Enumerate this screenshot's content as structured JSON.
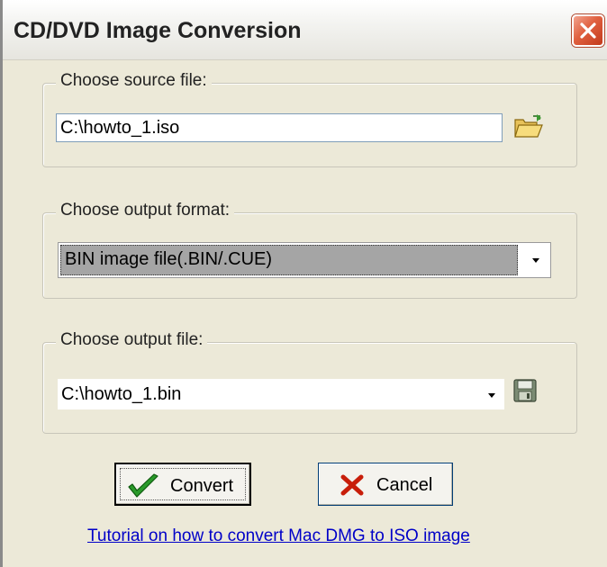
{
  "window": {
    "title": "CD/DVD Image Conversion",
    "accent_color": "#e0603f",
    "close_icon": "close-icon"
  },
  "source": {
    "legend": "Choose source file:",
    "value": "C:\\howto_1.iso",
    "browse_icon": "open-folder-icon"
  },
  "format": {
    "legend": "Choose output format:",
    "selected": "BIN image file(.BIN/.CUE)"
  },
  "output": {
    "legend": "Choose output file:",
    "value": "C:\\howto_1.bin",
    "save_icon": "save-disk-icon"
  },
  "buttons": {
    "convert_label": "Convert",
    "cancel_label": "Cancel",
    "convert_icon": "checkmark-icon",
    "cancel_icon": "x-icon"
  },
  "link": {
    "text": "Tutorial on how to convert Mac DMG to ISO image"
  }
}
